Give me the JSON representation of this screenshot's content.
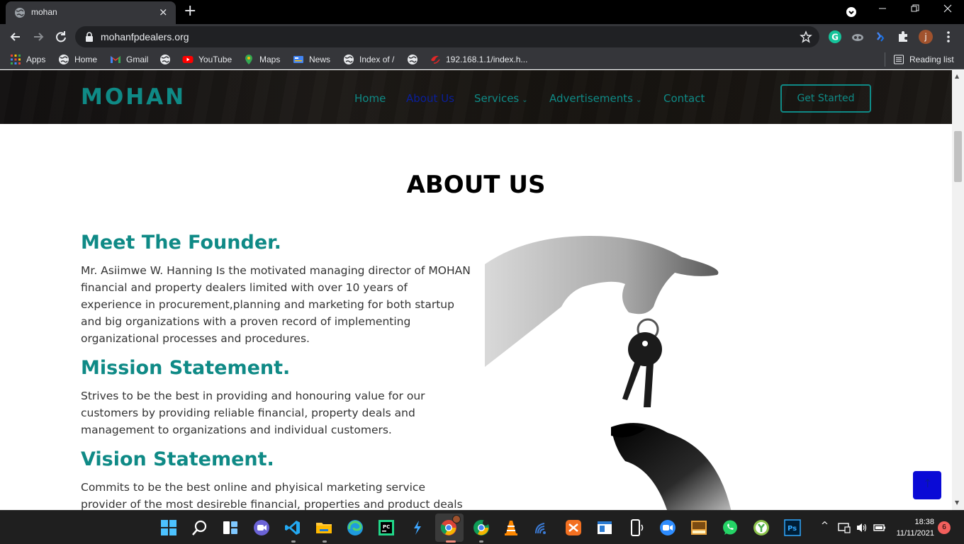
{
  "browser": {
    "tab_title": "mohan",
    "close_symbol": "×",
    "new_tab_symbol": "+",
    "url": "mohanfpdealers.org",
    "profile_initial": "j",
    "bookmarks": [
      {
        "label": "Apps",
        "icon": "apps-grid-icon"
      },
      {
        "label": "Home",
        "icon": "globe-icon"
      },
      {
        "label": "Gmail",
        "icon": "gmail-icon"
      },
      {
        "label": "",
        "icon": "globe-icon"
      },
      {
        "label": "YouTube",
        "icon": "youtube-icon"
      },
      {
        "label": "Maps",
        "icon": "maps-pin-icon"
      },
      {
        "label": "News",
        "icon": "news-icon"
      },
      {
        "label": "Index of /",
        "icon": "globe-icon"
      },
      {
        "label": "",
        "icon": "globe-icon"
      },
      {
        "label": "192.168.1.1/index.h...",
        "icon": "router-icon"
      }
    ],
    "reading_list": "Reading list"
  },
  "site": {
    "logo": "MOHAN",
    "nav": {
      "home": "Home",
      "about": "About Us",
      "services": "Services",
      "ads": "Advertisements",
      "contact": "Contact",
      "chevron": "⌄"
    },
    "cta": "Get Started",
    "colors": {
      "accent": "#0f8a86",
      "active_nav": "#0a1f9c",
      "back_to_top": "#0a0ad6"
    }
  },
  "about": {
    "title": "ABOUT US",
    "founder_heading": "Meet The Founder.",
    "founder_text": "Mr. Asiimwe W. Hanning Is the motivated managing director of MOHAN financial and property dealers limited with over 10 years of experience in procurement,planning and marketing for both startup and big organizations with a proven record of implementing organizational processes and procedures.",
    "mission_heading": "Mission Statement.",
    "mission_text": "Strives to be the best in providing and honouring value for our customers by providing reliable financial, property deals and management to organizations and individual customers.",
    "vision_heading": "Vision Statement.",
    "vision_text": "Commits to be the best online and phyisical marketing service provider of the most desireble financial, properties and product deals in Uganda"
  },
  "back_to_top": {
    "arrow": "↑"
  },
  "taskbar": {
    "time": "18:38",
    "date": "11/11/2021",
    "notification_count": "6",
    "tray_caret": "^"
  }
}
